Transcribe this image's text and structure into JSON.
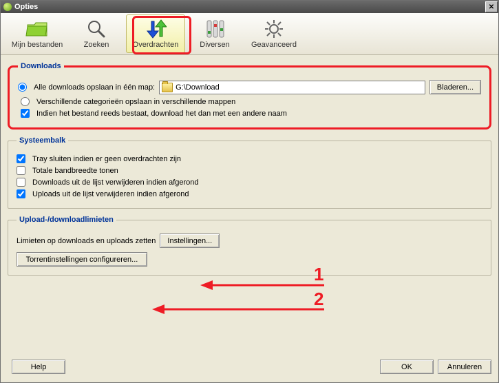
{
  "window": {
    "title": "Opties"
  },
  "toolbar": {
    "tabs": [
      {
        "id": "mijn-bestanden",
        "label": "Mijn bestanden"
      },
      {
        "id": "zoeken",
        "label": "Zoeken"
      },
      {
        "id": "overdrachten",
        "label": "Overdrachten"
      },
      {
        "id": "diversen",
        "label": "Diversen"
      },
      {
        "id": "geavanceerd",
        "label": "Geavanceerd"
      }
    ],
    "active": "overdrachten"
  },
  "groups": {
    "downloads": {
      "legend": "Downloads",
      "opt_single_folder": "Alle downloads opslaan in één map:",
      "path_value": "G:\\Download",
      "browse_label": "Bladeren...",
      "opt_per_category": "Verschillende categorieën opslaan in verschillende mappen",
      "chk_rename_existing": "Indien het bestand reeds bestaat, download het dan met een andere naam"
    },
    "systray": {
      "legend": "Systeembalk",
      "chk_tray_close": "Tray sluiten indien er geen overdrachten zijn",
      "chk_show_bandwidth": "Totale bandbreedte tonen",
      "chk_remove_downloads": "Downloads uit de lijst verwijderen indien afgerond",
      "chk_remove_uploads": "Uploads uit de lijst verwijderen indien afgerond"
    },
    "limits": {
      "legend": "Upload-/downloadlimieten",
      "label": "Limieten op downloads en uploads zetten",
      "settings_btn": "Instellingen...",
      "torrent_btn": "Torrentinstellingen configureren..."
    }
  },
  "buttons": {
    "help": "Help",
    "ok": "OK",
    "cancel": "Annuleren"
  },
  "state": {
    "download_mode": "single",
    "rename_existing": true,
    "tray_close": true,
    "show_bandwidth": false,
    "remove_downloads": false,
    "remove_uploads": true
  },
  "annotations": {
    "one": "1",
    "two": "2"
  },
  "colors": {
    "accent_red": "#ee1c25"
  }
}
